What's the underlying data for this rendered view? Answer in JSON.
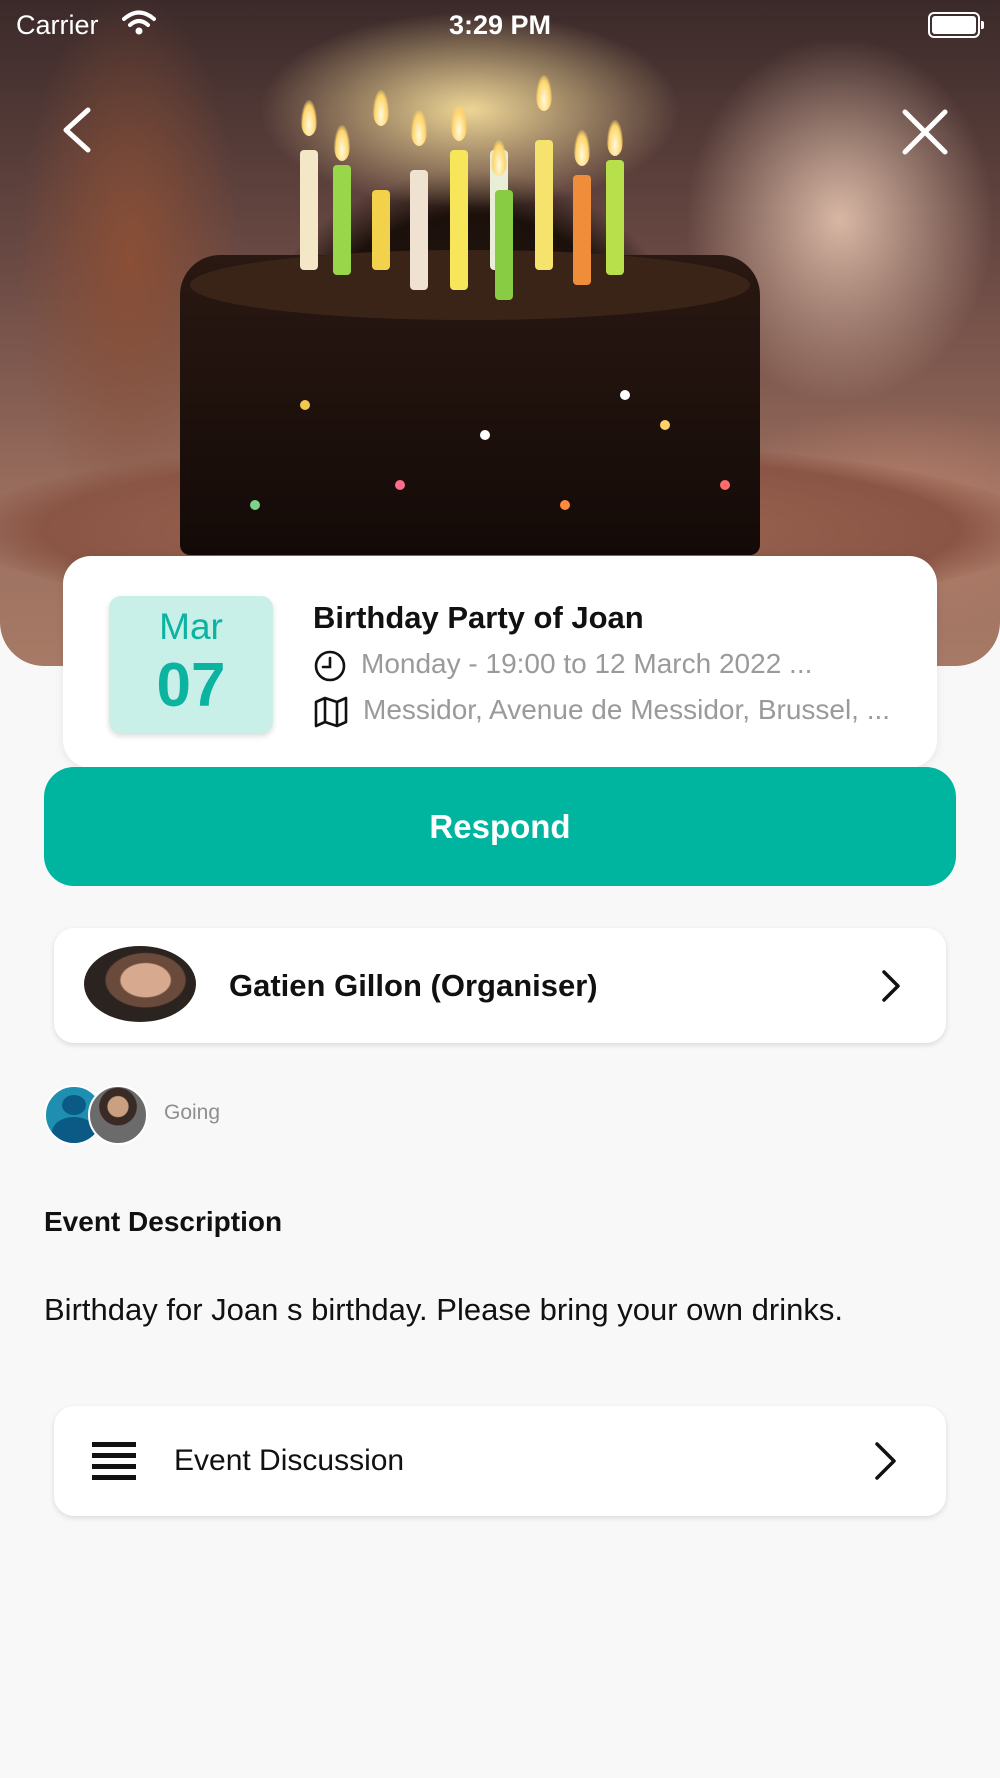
{
  "status_bar": {
    "carrier": "Carrier",
    "time": "3:29 PM"
  },
  "hero": {
    "image": "birthday cake with candles",
    "back_icon": "chevron-left-icon",
    "close_icon": "close-icon"
  },
  "event": {
    "month": "Mar",
    "day": "07",
    "title": "Birthday Party of Joan",
    "time": "Monday - 19:00 to 12 March 2022 ...",
    "location": "Messidor, Avenue de Messidor, Brussel, ..."
  },
  "actions": {
    "respond_label": "Respond"
  },
  "organiser": {
    "name": "Gatien Gillon (Organiser)"
  },
  "attendees": {
    "label": "Going"
  },
  "description": {
    "heading": "Event Description",
    "text": "Birthday for Joan s birthday. Please bring your own drinks."
  },
  "discussion": {
    "label": "Event Discussion"
  },
  "colors": {
    "accent": "#00b5a0",
    "date_bg": "#c9efe9",
    "date_text": "#0bb3a0",
    "muted": "#9a9a9a"
  }
}
